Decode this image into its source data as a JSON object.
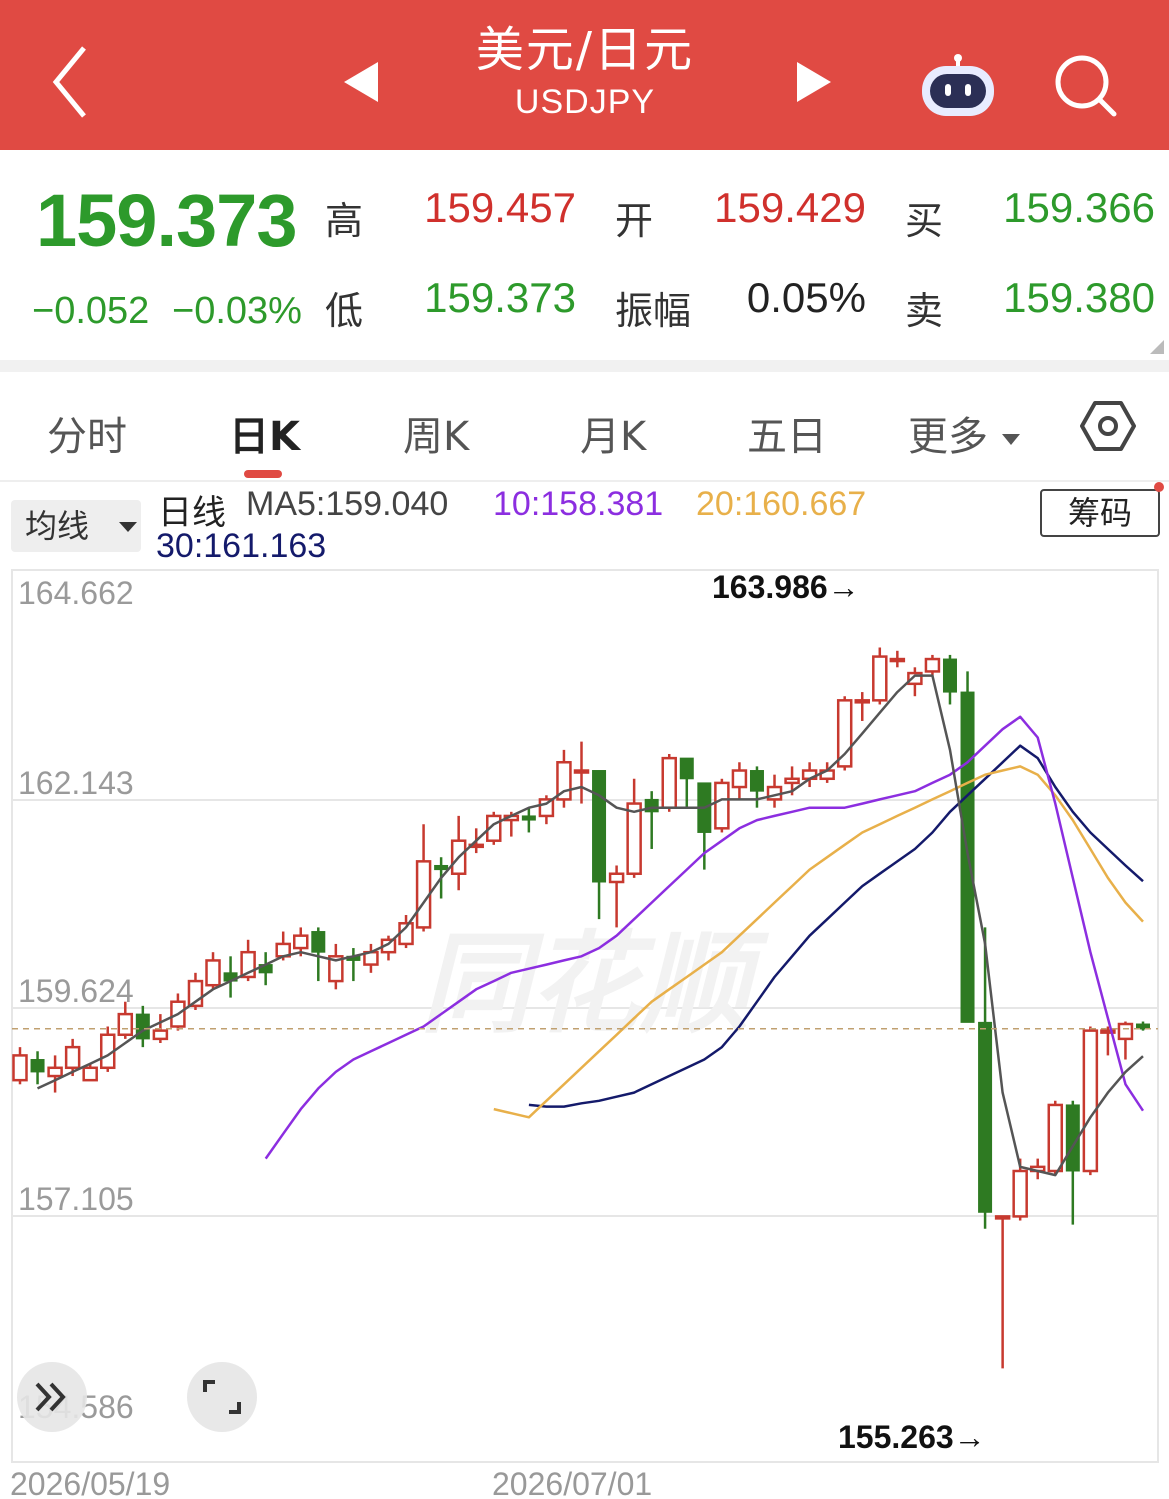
{
  "header": {
    "title_cn": "美元/日元",
    "title_en": "USDJPY"
  },
  "quote": {
    "price": "159.373",
    "change": "−0.052",
    "change_pct": "−0.03%",
    "high_label": "高",
    "high": "159.457",
    "low_label": "低",
    "low": "159.373",
    "open_label": "开",
    "open": "159.429",
    "amp_label": "振幅",
    "amp": "0.05%",
    "buy_label": "买",
    "buy": "159.366",
    "sell_label": "卖",
    "sell": "159.380"
  },
  "tabs": [
    "分时",
    "日K",
    "周K",
    "月K",
    "五日",
    "更多"
  ],
  "ma_bar": {
    "button": "均线",
    "line_label": "日线",
    "ma5": "MA5:159.040",
    "ma10": "10:158.381",
    "ma20": "20:160.667",
    "ma30": "30:161.163",
    "chip_button": "筹码"
  },
  "colors": {
    "up": "#c7392f",
    "down": "#2e7a22",
    "ma5": "#555555",
    "ma10": "#8c2ee0",
    "ma20": "#e8b04a",
    "ma30": "#141a6b",
    "header": "#e04a43"
  },
  "chart_data": {
    "type": "candlestick",
    "y_tick_labels": [
      "164.662",
      "162.143",
      "159.624",
      "157.105",
      "154.586"
    ],
    "ylim": [
      154.586,
      164.662
    ],
    "x_tick_labels": [
      "2026/05/19",
      "2026/07/01"
    ],
    "max_label": "163.986→",
    "min_label": "155.263→",
    "current_line": 159.373,
    "watermark": "同花顺",
    "candles": [
      [
        158.75,
        159.05,
        158.7,
        159.15
      ],
      [
        159.0,
        158.85,
        158.7,
        159.1
      ],
      [
        158.8,
        158.9,
        158.6,
        159.05
      ],
      [
        158.9,
        159.15,
        158.8,
        159.25
      ],
      [
        158.75,
        158.9,
        158.75,
        158.95
      ],
      [
        158.9,
        159.3,
        158.85,
        159.4
      ],
      [
        159.3,
        159.55,
        159.25,
        159.7
      ],
      [
        159.55,
        159.25,
        159.15,
        159.65
      ],
      [
        159.25,
        159.35,
        159.2,
        159.55
      ],
      [
        159.4,
        159.7,
        159.35,
        159.8
      ],
      [
        159.65,
        159.95,
        159.6,
        160.05
      ],
      [
        159.9,
        160.2,
        159.85,
        160.3
      ],
      [
        160.05,
        159.95,
        159.75,
        160.25
      ],
      [
        160.0,
        160.3,
        159.95,
        160.45
      ],
      [
        160.15,
        160.05,
        159.9,
        160.3
      ],
      [
        160.25,
        160.4,
        160.2,
        160.55
      ],
      [
        160.35,
        160.5,
        160.25,
        160.6
      ],
      [
        160.55,
        160.3,
        159.95,
        160.6
      ],
      [
        159.95,
        160.25,
        159.85,
        160.4
      ],
      [
        160.25,
        160.2,
        159.95,
        160.35
      ],
      [
        160.15,
        160.3,
        160.05,
        160.4
      ],
      [
        160.3,
        160.45,
        160.2,
        160.5
      ],
      [
        160.4,
        160.65,
        160.35,
        160.75
      ],
      [
        160.6,
        161.4,
        160.55,
        161.85
      ],
      [
        161.35,
        161.3,
        160.95,
        161.45
      ],
      [
        161.25,
        161.65,
        161.05,
        161.95
      ],
      [
        161.6,
        161.6,
        161.5,
        161.8
      ],
      [
        161.65,
        161.95,
        161.6,
        162.0
      ],
      [
        161.9,
        161.95,
        161.7,
        162.0
      ],
      [
        161.95,
        161.9,
        161.75,
        162.05
      ],
      [
        161.95,
        162.15,
        161.85,
        162.2
      ],
      [
        162.15,
        162.6,
        162.05,
        162.75
      ],
      [
        162.5,
        162.5,
        162.1,
        162.85
      ],
      [
        162.5,
        161.15,
        160.7,
        162.5
      ],
      [
        161.15,
        161.25,
        160.6,
        161.35
      ],
      [
        161.25,
        162.1,
        161.2,
        162.4
      ],
      [
        162.15,
        162.0,
        161.55,
        162.25
      ],
      [
        162.05,
        162.65,
        162.0,
        162.7
      ],
      [
        162.65,
        162.4,
        162.05,
        162.65
      ],
      [
        162.35,
        161.75,
        161.3,
        162.35
      ],
      [
        161.8,
        162.35,
        161.75,
        162.4
      ],
      [
        162.3,
        162.5,
        162.15,
        162.6
      ],
      [
        162.5,
        162.25,
        162.05,
        162.55
      ],
      [
        162.15,
        162.3,
        162.05,
        162.45
      ],
      [
        162.35,
        162.4,
        162.2,
        162.55
      ],
      [
        162.4,
        162.5,
        162.3,
        162.6
      ],
      [
        162.4,
        162.5,
        162.35,
        162.6
      ],
      [
        162.55,
        163.35,
        162.5,
        163.4
      ],
      [
        163.35,
        163.35,
        163.1,
        163.45
      ],
      [
        163.35,
        163.88,
        163.3,
        163.99
      ],
      [
        163.85,
        163.85,
        163.75,
        163.95
      ],
      [
        163.55,
        163.68,
        163.4,
        163.75
      ],
      [
        163.7,
        163.85,
        163.65,
        163.9
      ],
      [
        163.85,
        163.45,
        163.3,
        163.9
      ],
      [
        163.45,
        159.45,
        159.45,
        163.7
      ],
      [
        159.45,
        157.15,
        156.95,
        160.6
      ],
      [
        157.1,
        157.1,
        155.26,
        157.1
      ],
      [
        157.1,
        157.65,
        157.05,
        157.8
      ],
      [
        157.65,
        157.7,
        157.55,
        157.8
      ],
      [
        157.65,
        158.45,
        157.6,
        158.5
      ],
      [
        158.45,
        157.65,
        157.0,
        158.5
      ],
      [
        157.65,
        159.35,
        157.6,
        159.4
      ],
      [
        159.35,
        159.35,
        159.05,
        159.4
      ],
      [
        159.25,
        159.43,
        159.0,
        159.46
      ],
      [
        159.43,
        159.37,
        159.35,
        159.46
      ]
    ],
    "ma5": [
      158.65,
      158.75,
      158.85,
      158.95,
      159.05,
      159.2,
      159.35,
      159.45,
      159.55,
      159.7,
      159.85,
      159.95,
      160.05,
      160.15,
      160.25,
      160.3,
      160.25,
      160.2,
      160.25,
      160.3,
      160.4,
      160.6,
      160.9,
      161.2,
      161.45,
      161.65,
      161.85,
      161.95,
      162.05,
      162.1,
      162.25,
      162.3,
      162.2,
      162.05,
      162.0,
      162.05,
      162.05,
      162.05,
      162.05,
      162.15,
      162.15,
      162.15,
      162.2,
      162.25,
      162.4,
      162.5,
      162.7,
      162.95,
      163.2,
      163.45,
      163.65,
      163.65,
      162.75,
      161.5,
      160.4,
      158.6,
      157.7,
      157.65,
      157.6,
      157.95,
      158.3,
      158.6,
      158.85,
      159.04
    ],
    "ma10": [
      157.8,
      158.1,
      158.4,
      158.65,
      158.85,
      159.0,
      159.1,
      159.2,
      159.3,
      159.4,
      159.55,
      159.7,
      159.85,
      159.95,
      160.05,
      160.1,
      160.15,
      160.2,
      160.25,
      160.35,
      160.5,
      160.7,
      160.9,
      161.1,
      161.3,
      161.5,
      161.65,
      161.8,
      161.9,
      161.95,
      162.0,
      162.05,
      162.05,
      162.05,
      162.1,
      162.15,
      162.2,
      162.25,
      162.35,
      162.45,
      162.6,
      162.8,
      163.0,
      163.15,
      162.9,
      162.1,
      161.2,
      160.3,
      159.5,
      158.7,
      158.38
    ],
    "ma20": [
      158.4,
      158.35,
      158.3,
      158.5,
      158.7,
      158.9,
      159.1,
      159.3,
      159.5,
      159.7,
      159.85,
      160.0,
      160.15,
      160.3,
      160.5,
      160.7,
      160.9,
      161.1,
      161.3,
      161.45,
      161.6,
      161.75,
      161.85,
      161.95,
      162.05,
      162.15,
      162.25,
      162.35,
      162.45,
      162.5,
      162.55,
      162.45,
      162.2,
      161.9,
      161.55,
      161.2,
      160.9,
      160.67
    ],
    "ma30": [
      158.45,
      158.43,
      158.43,
      158.47,
      158.5,
      158.55,
      158.6,
      158.7,
      158.8,
      158.9,
      159.0,
      159.15,
      159.4,
      159.7,
      160.0,
      160.25,
      160.5,
      160.7,
      160.9,
      161.1,
      161.25,
      161.4,
      161.55,
      161.75,
      162.0,
      162.2,
      162.4,
      162.6,
      162.8,
      162.65,
      162.3,
      162.0,
      161.75,
      161.55,
      161.35,
      161.16
    ]
  },
  "controls": {
    "expand_icon": "double-chevron-right-icon",
    "fullscreen_icon": "fullscreen-icon"
  }
}
